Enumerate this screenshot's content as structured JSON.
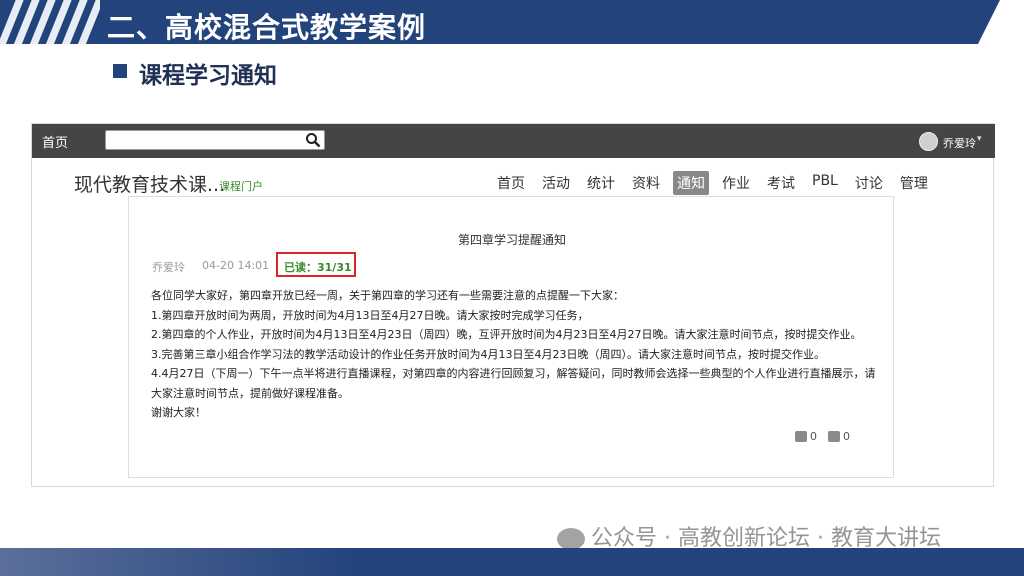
{
  "slide": {
    "title": "二、高校混合式教学案例",
    "section": "课程学习通知"
  },
  "topbar": {
    "home": "首页",
    "search_placeholder": "",
    "username": "乔爱玲"
  },
  "course": {
    "name": "现代教育技术课...",
    "portal": "课程门户"
  },
  "nav": [
    "首页",
    "活动",
    "统计",
    "资料",
    "通知",
    "作业",
    "考试",
    "PBL",
    "讨论",
    "管理"
  ],
  "nav_active": "通知",
  "notice": {
    "title": "第四章学习提醒通知",
    "author": "乔爱玲",
    "time": "04-20 14:01",
    "read": "已读：31/31",
    "lines": [
      "各位同学大家好，第四章开放已经一周，关于第四章的学习还有一些需要注意的点提醒一下大家：",
      "1.第四章开放时间为两周，开放时间为4月13日至4月27日晚。请大家按时完成学习任务，",
      "2.第四章的个人作业，开放时间为4月13日至4月23日（周四）晚，互评开放时间为4月23日至4月27日晚。请大家注意时间节点，按时提交作业。",
      "3.完善第三章小组合作学习法的教学活动设计的作业任务开放时间为4月13日至4月23日晚（周四）。请大家注意时间节点，按时提交作业。",
      "4.4月27日（下周一）下午一点半将进行直播课程，对第四章的内容进行回顾复习，解答疑问，同时教师会选择一些典型的个人作业进行直播展示，请大家注意时间节点，提前做好课程准备。",
      "谢谢大家！"
    ],
    "likes": "0",
    "comments": "0"
  },
  "watermark": "公众号 · 高教创新论坛 · 教育大讲坛",
  "colors": {
    "brand": "#23437c",
    "highlight": "#d9262a",
    "green": "#3a8a2a"
  }
}
